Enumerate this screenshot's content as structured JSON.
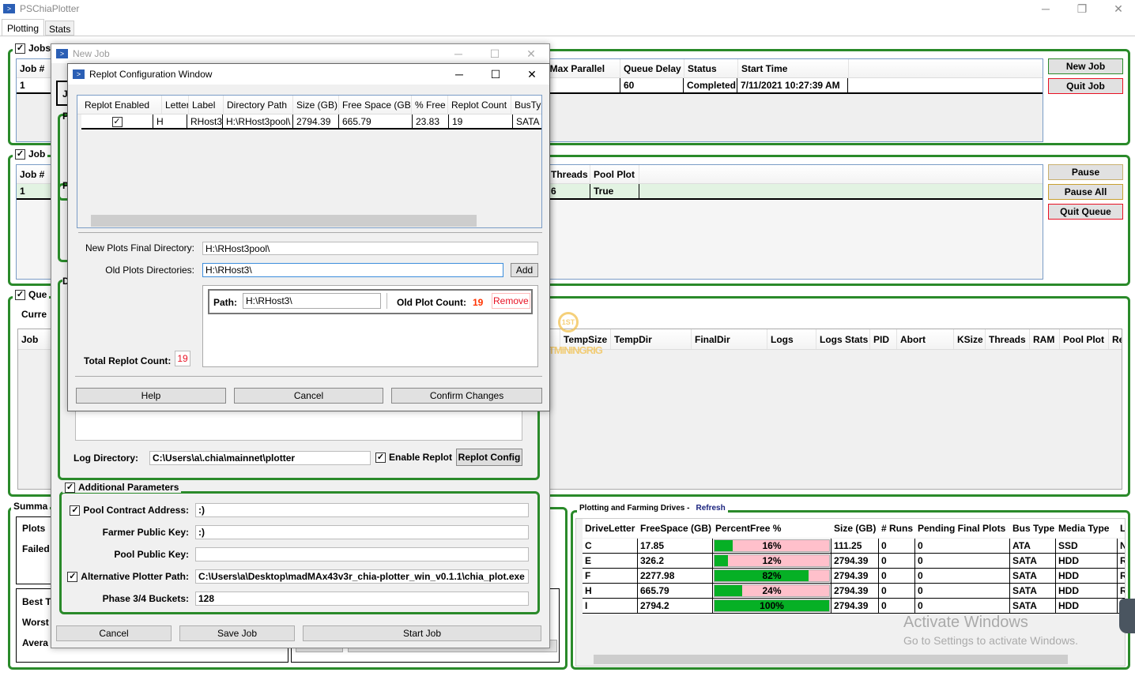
{
  "app": {
    "title": "PSChiaPlotter",
    "tabs": [
      "Plotting",
      "Stats"
    ]
  },
  "colors": {
    "group_border": "#2a8a2a",
    "accent_blue": "#2b5fb5",
    "bar_fill": "#06b025",
    "bar_empty": "#ffc0cb",
    "danger": "#e81123"
  },
  "jobs": {
    "label": "Jobs",
    "header_partial": "Job #",
    "row_partial": "1",
    "columns": [
      "re Max Parallel",
      "Queue Delay",
      "Status",
      "Start Time"
    ],
    "row": [
      "",
      "60",
      "Completed",
      "7/11/2021 10:27:39 AM"
    ],
    "buttons": [
      "New Job",
      "Quit Job"
    ]
  },
  "queues": {
    "label": "Job",
    "header_partial": "Job #",
    "row_partial": "1",
    "columns": [
      "Threads",
      "Pool Plot"
    ],
    "row": [
      "6",
      "True"
    ],
    "buttons": [
      "Pause",
      "Pause All",
      "Quit Queue"
    ]
  },
  "runs": {
    "label": "Que",
    "current_partial": "Curre",
    "job_partial": "Job",
    "columns": [
      "TempSize",
      "TempDir",
      "FinalDir",
      "Logs",
      "Logs Stats",
      "PID",
      "Abort",
      "KSize",
      "Threads",
      "RAM",
      "Pool Plot",
      "Re"
    ]
  },
  "summary": {
    "label": "Summa",
    "items": [
      "Plots",
      "Failed",
      "Best T",
      "Worst",
      "Avera"
    ]
  },
  "drives": {
    "label": "Plotting and Farming Drives -",
    "refresh": "Refresh",
    "columns": [
      "DriveLetter",
      "FreeSpace (GB)",
      "PercentFree %",
      "Size (GB)",
      "# Runs",
      "Pending Final Plots",
      "Bus Type",
      "Media Type",
      "L"
    ],
    "rows": [
      {
        "letter": "C",
        "free": "17.85",
        "percent": 16,
        "percent_label": "16%",
        "size": "111.25",
        "runs": "0",
        "pending": "0",
        "bus": "ATA",
        "media": "SSD",
        "l": "N"
      },
      {
        "letter": "E",
        "free": "326.2",
        "percent": 12,
        "percent_label": "12%",
        "size": "2794.39",
        "runs": "0",
        "pending": "0",
        "bus": "SATA",
        "media": "HDD",
        "l": "R"
      },
      {
        "letter": "F",
        "free": "2277.98",
        "percent": 82,
        "percent_label": "82%",
        "size": "2794.39",
        "runs": "0",
        "pending": "0",
        "bus": "SATA",
        "media": "HDD",
        "l": "R"
      },
      {
        "letter": "H",
        "free": "665.79",
        "percent": 24,
        "percent_label": "24%",
        "size": "2794.39",
        "runs": "0",
        "pending": "0",
        "bus": "SATA",
        "media": "HDD",
        "l": "R"
      },
      {
        "letter": "I",
        "free": "2794.2",
        "percent": 100,
        "percent_label": "100%",
        "size": "2794.39",
        "runs": "0",
        "pending": "0",
        "bus": "SATA",
        "media": "HDD",
        "l": ""
      }
    ]
  },
  "newjob": {
    "title": "New Job",
    "partial_jo": "Jo",
    "partial_p": "P",
    "partial_d": "D",
    "log_label": "Log Directory:",
    "log_value": "C:\\Users\\a\\.chia\\mainnet\\plotter",
    "enable_replot": "Enable Replot",
    "replot_config": "Replot Config",
    "additional": "Additional Parameters",
    "params": [
      {
        "label": "Pool Contract Address:",
        "value": ":)",
        "checkbox": true
      },
      {
        "label": "Farmer Public Key:",
        "value": ":)",
        "checkbox": false
      },
      {
        "label": "Pool Public Key:",
        "value": "",
        "checkbox": false
      },
      {
        "label": "Alternative Plotter Path:",
        "value": "C:\\Users\\a\\Desktop\\madMAx43v3r_chia-plotter_win_v0.1.1\\chia_plot.exe",
        "checkbox": true
      },
      {
        "label": "Phase 3/4 Buckets:",
        "value": "128",
        "checkbox": false
      }
    ],
    "buttons": [
      "Cancel",
      "Save Job",
      "Start Job"
    ]
  },
  "replot": {
    "title": "Replot Configuration Window",
    "columns": [
      "Replot Enabled",
      "Letter",
      "Label",
      "Directory Path",
      "Size (GB)",
      "Free Space (GB)",
      "% Free",
      "Replot Count",
      "BusTyp"
    ],
    "row": {
      "enabled": true,
      "letter": "H",
      "label": "RHost3",
      "path": "H:\\RHost3pool\\",
      "size": "2794.39",
      "free": "665.79",
      "pct": "23.83",
      "count": "19",
      "bus": "SATA"
    },
    "new_final_label": "New Plots Final Directory:",
    "new_final_value": "H:\\RHost3pool\\",
    "old_dirs_label": "Old Plots Directories:",
    "old_dirs_value": "H:\\RHost3\\",
    "add": "Add",
    "path_label": "Path:",
    "path_value": "H:\\RHost3\\",
    "old_count_label": "Old Plot Count:",
    "old_count": "19",
    "remove": "Remove",
    "total_label": "Total Replot Count:",
    "total": "19",
    "buttons": [
      "Help",
      "Cancel",
      "Confirm Changes"
    ]
  },
  "watermark": {
    "line1": "Activate Windows",
    "line2": "Go to Settings to activate Windows.",
    "logo": "1STMININGRIG"
  }
}
